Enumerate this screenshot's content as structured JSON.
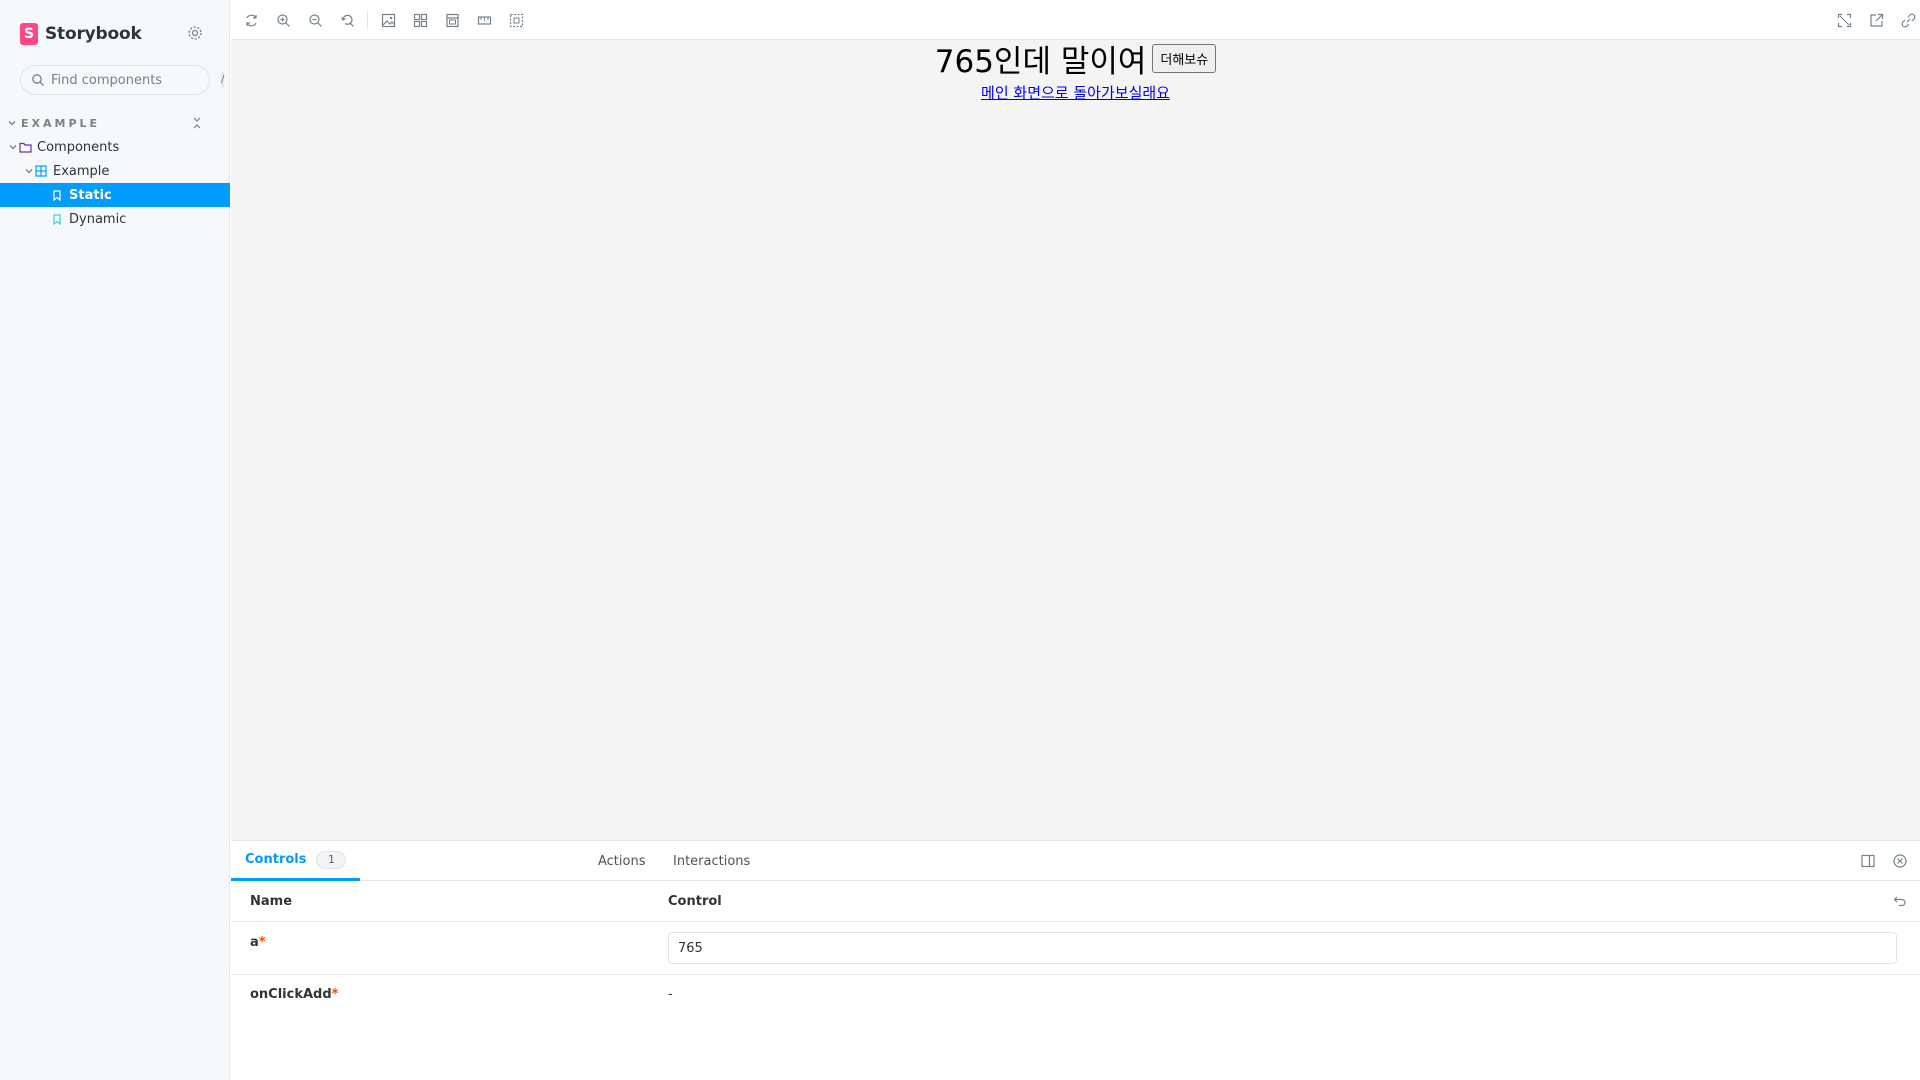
{
  "app": {
    "brand_name": "Storybook",
    "brand_letter": "S",
    "accent": "#029cfd",
    "brand_color": "#ff4785"
  },
  "sidebar": {
    "search_placeholder": "Find components",
    "search_shortcut": "/",
    "section_title": "EXAMPLE",
    "tree": {
      "components": "Components",
      "example": "Example",
      "static": "Static",
      "dynamic": "Dynamic"
    }
  },
  "story": {
    "heading": "765인데 말이여",
    "button_label": "더해보슈",
    "link_text": "메인 화면으로 돌아가보실래요"
  },
  "panel": {
    "tabs": {
      "controls": "Controls",
      "controls_count": "1",
      "actions": "Actions",
      "interactions": "Interactions"
    },
    "table": {
      "col_name": "Name",
      "col_control": "Control",
      "rows": [
        {
          "name": "a",
          "required": "*",
          "value": "765"
        },
        {
          "name": "onClickAdd",
          "required": "*",
          "value": "-"
        }
      ]
    }
  }
}
